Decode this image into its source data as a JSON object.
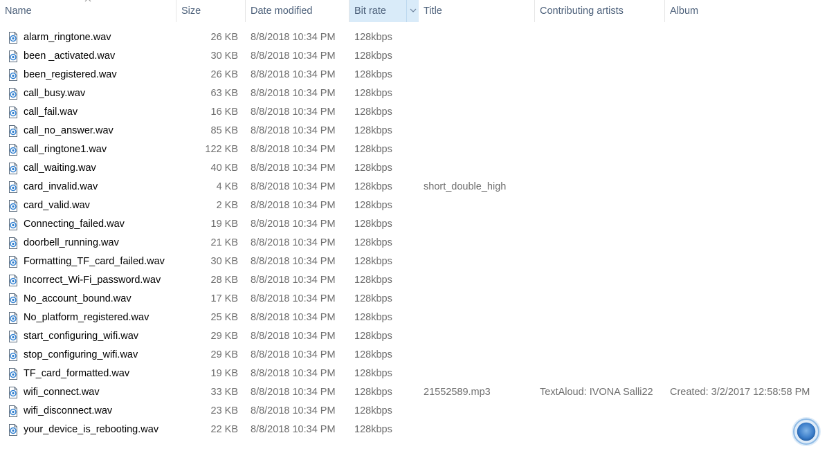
{
  "columns": {
    "name": "Name",
    "size": "Size",
    "date_modified": "Date modified",
    "bit_rate": "Bit rate",
    "title": "Title",
    "contributing_artists": "Contributing artists",
    "album": "Album"
  },
  "files": [
    {
      "name": "alarm_ringtone.wav",
      "size": "26 KB",
      "date": "8/8/2018 10:34 PM",
      "bitrate": "128kbps",
      "title": "",
      "artist": "",
      "album": ""
    },
    {
      "name": "been _activated.wav",
      "size": "30 KB",
      "date": "8/8/2018 10:34 PM",
      "bitrate": "128kbps",
      "title": "",
      "artist": "",
      "album": ""
    },
    {
      "name": "been_registered.wav",
      "size": "26 KB",
      "date": "8/8/2018 10:34 PM",
      "bitrate": "128kbps",
      "title": "",
      "artist": "",
      "album": ""
    },
    {
      "name": "call_busy.wav",
      "size": "63 KB",
      "date": "8/8/2018 10:34 PM",
      "bitrate": "128kbps",
      "title": "",
      "artist": "",
      "album": ""
    },
    {
      "name": "call_fail.wav",
      "size": "16 KB",
      "date": "8/8/2018 10:34 PM",
      "bitrate": "128kbps",
      "title": "",
      "artist": "",
      "album": ""
    },
    {
      "name": "call_no_answer.wav",
      "size": "85 KB",
      "date": "8/8/2018 10:34 PM",
      "bitrate": "128kbps",
      "title": "",
      "artist": "",
      "album": ""
    },
    {
      "name": "call_ringtone1.wav",
      "size": "122 KB",
      "date": "8/8/2018 10:34 PM",
      "bitrate": "128kbps",
      "title": "",
      "artist": "",
      "album": ""
    },
    {
      "name": "call_waiting.wav",
      "size": "40 KB",
      "date": "8/8/2018 10:34 PM",
      "bitrate": "128kbps",
      "title": "",
      "artist": "",
      "album": ""
    },
    {
      "name": "card_invalid.wav",
      "size": "4 KB",
      "date": "8/8/2018 10:34 PM",
      "bitrate": "128kbps",
      "title": "short_double_high",
      "artist": "",
      "album": ""
    },
    {
      "name": "card_valid.wav",
      "size": "2 KB",
      "date": "8/8/2018 10:34 PM",
      "bitrate": "128kbps",
      "title": "",
      "artist": "",
      "album": ""
    },
    {
      "name": "Connecting_failed.wav",
      "size": "19 KB",
      "date": "8/8/2018 10:34 PM",
      "bitrate": "128kbps",
      "title": "",
      "artist": "",
      "album": ""
    },
    {
      "name": "doorbell_running.wav",
      "size": "21 KB",
      "date": "8/8/2018 10:34 PM",
      "bitrate": "128kbps",
      "title": "",
      "artist": "",
      "album": ""
    },
    {
      "name": "Formatting_TF_card_failed.wav",
      "size": "30 KB",
      "date": "8/8/2018 10:34 PM",
      "bitrate": "128kbps",
      "title": "",
      "artist": "",
      "album": ""
    },
    {
      "name": "Incorrect_Wi-Fi_password.wav",
      "size": "28 KB",
      "date": "8/8/2018 10:34 PM",
      "bitrate": "128kbps",
      "title": "",
      "artist": "",
      "album": ""
    },
    {
      "name": "No_account_bound.wav",
      "size": "17 KB",
      "date": "8/8/2018 10:34 PM",
      "bitrate": "128kbps",
      "title": "",
      "artist": "",
      "album": ""
    },
    {
      "name": "No_platform_registered.wav",
      "size": "25 KB",
      "date": "8/8/2018 10:34 PM",
      "bitrate": "128kbps",
      "title": "",
      "artist": "",
      "album": ""
    },
    {
      "name": "start_configuring_wifi.wav",
      "size": "29 KB",
      "date": "8/8/2018 10:34 PM",
      "bitrate": "128kbps",
      "title": "",
      "artist": "",
      "album": ""
    },
    {
      "name": "stop_configuring_wifi.wav",
      "size": "29 KB",
      "date": "8/8/2018 10:34 PM",
      "bitrate": "128kbps",
      "title": "",
      "artist": "",
      "album": ""
    },
    {
      "name": "TF_card_formatted.wav",
      "size": "19 KB",
      "date": "8/8/2018 10:34 PM",
      "bitrate": "128kbps",
      "title": "",
      "artist": "",
      "album": ""
    },
    {
      "name": "wifi_connect.wav",
      "size": "33 KB",
      "date": "8/8/2018 10:34 PM",
      "bitrate": "128kbps",
      "title": "21552589.mp3",
      "artist": "TextAloud: IVONA Salli22",
      "album": "Created: 3/2/2017 12:58:58 PM"
    },
    {
      "name": "wifi_disconnect.wav",
      "size": "23 KB",
      "date": "8/8/2018 10:34 PM",
      "bitrate": "128kbps",
      "title": "",
      "artist": "",
      "album": ""
    },
    {
      "name": "your_device_is_rebooting.wav",
      "size": "22 KB",
      "date": "8/8/2018 10:34 PM",
      "bitrate": "128kbps",
      "title": "",
      "artist": "",
      "album": ""
    }
  ],
  "icons": {
    "file": "audio-file-icon",
    "sort": "sort-ascending-icon",
    "dropdown": "chevron-down-icon",
    "overlay": "cortana-icon"
  },
  "colors": {
    "active_header": "#d9ebf9",
    "header_text": "#4c607a",
    "detail_text": "#6d6d6d"
  }
}
